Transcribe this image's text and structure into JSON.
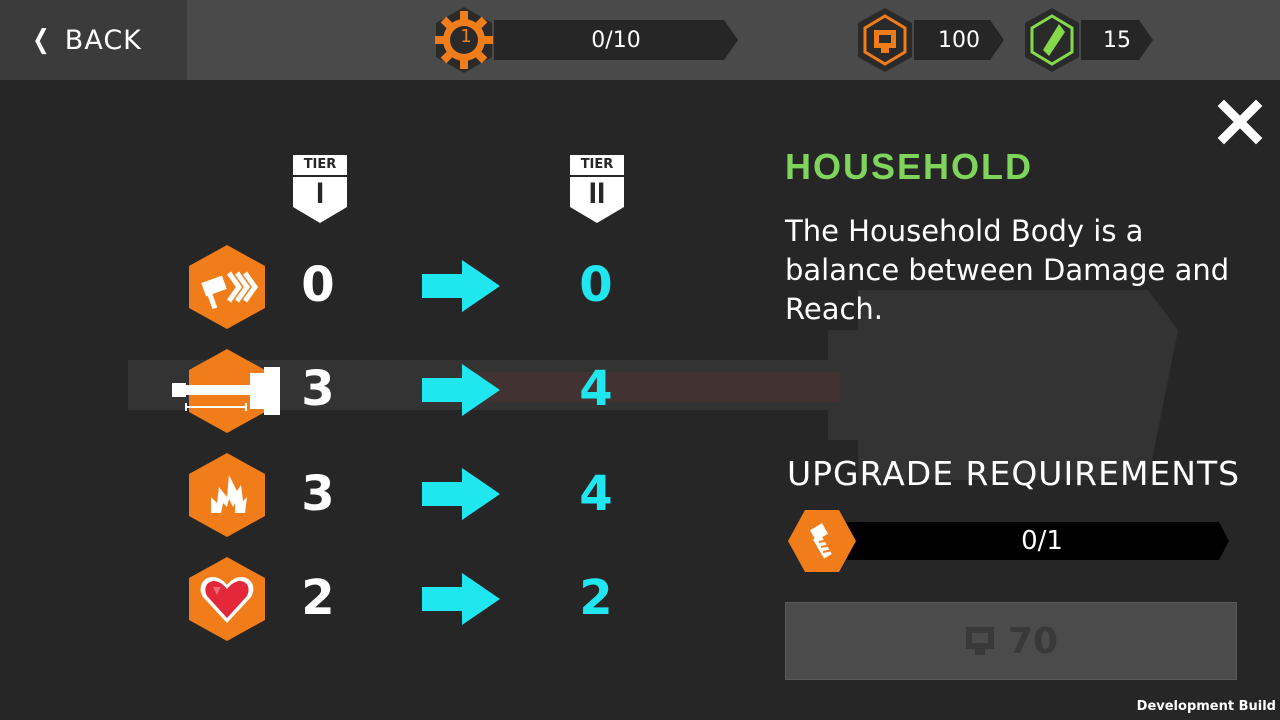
{
  "topbar": {
    "back_label": "BACK",
    "level": "1",
    "progress": "0/10",
    "currency_coins": "100",
    "currency_gems": "15"
  },
  "tiers": {
    "current_label": "TIER",
    "current_numeral": "I",
    "next_label": "TIER",
    "next_numeral": "II"
  },
  "stats": [
    {
      "icon": "speed-hammer-icon",
      "current": "0",
      "next": "0"
    },
    {
      "icon": "reach-hammer-icon",
      "current": "3",
      "next": "4"
    },
    {
      "icon": "fire-damage-icon",
      "current": "3",
      "next": "4"
    },
    {
      "icon": "heart-health-icon",
      "current": "2",
      "next": "2"
    }
  ],
  "info": {
    "title": "HOUSEHOLD",
    "description": "The Household Body is a balance between Damage and Reach.",
    "requirements_title": "UPGRADE REQUIREMENTS",
    "requirement_progress": "0/1",
    "upgrade_cost": "70"
  },
  "footer": {
    "dev_build": "Development Build"
  },
  "colors": {
    "accent_orange": "#f07d1a",
    "accent_cyan": "#20e6f0",
    "accent_green": "#7fd45c",
    "background": "#262627"
  }
}
